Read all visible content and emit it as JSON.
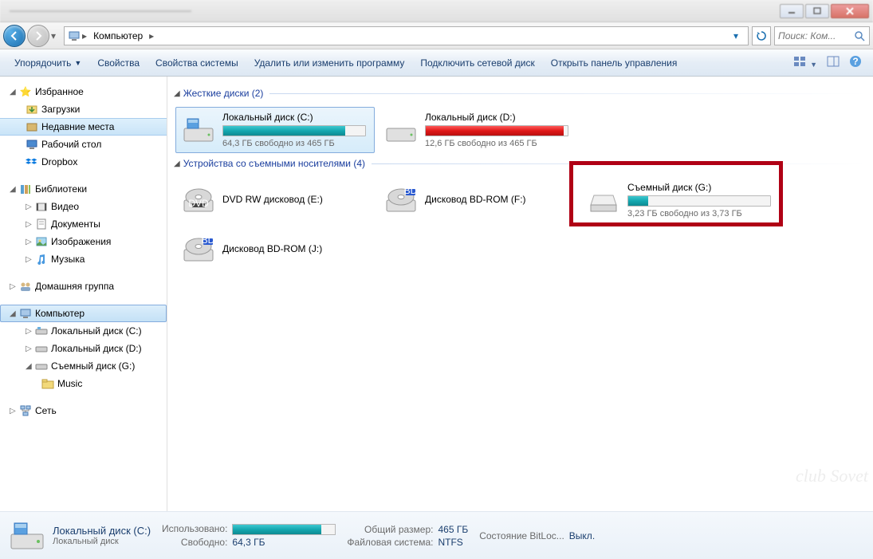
{
  "breadcrumb": {
    "item": "Компьютер"
  },
  "search": {
    "placeholder": "Поиск: Ком..."
  },
  "toolbar": {
    "organize": "Упорядочить",
    "properties": "Свойства",
    "sysprops": "Свойства системы",
    "uninstall": "Удалить или изменить программу",
    "mapnet": "Подключить сетевой диск",
    "controlpanel": "Открыть панель управления"
  },
  "sidebar": {
    "favorites": {
      "label": "Избранное",
      "downloads": "Загрузки",
      "recent": "Недавние места",
      "desktop": "Рабочий стол",
      "dropbox": "Dropbox"
    },
    "libraries": {
      "label": "Библиотеки",
      "video": "Видео",
      "docs": "Документы",
      "pics": "Изображения",
      "music": "Музыка"
    },
    "homegroup": "Домашняя группа",
    "computer": {
      "label": "Компьютер",
      "c": "Локальный диск (C:)",
      "d": "Локальный диск (D:)",
      "g": "Съемный диск (G:)",
      "g_sub": "Music"
    },
    "network": "Сеть"
  },
  "groups": {
    "hdd": {
      "title": "Жесткие диски (2)"
    },
    "removable": {
      "title": "Устройства со съемными носителями (4)"
    }
  },
  "drives": {
    "c": {
      "name": "Локальный диск (C:)",
      "free": "64,3 ГБ свободно из 465 ГБ",
      "pct": 86
    },
    "d": {
      "name": "Локальный диск (D:)",
      "free": "12,6 ГБ свободно из 465 ГБ",
      "pct": 97
    },
    "dvd": {
      "name": "DVD RW дисковод (E:)"
    },
    "bdf": {
      "name": "Дисковод BD-ROM (F:)"
    },
    "g": {
      "name": "Съемный диск (G:)",
      "free": "3,23 ГБ свободно из 3,73 ГБ",
      "pct": 14
    },
    "bdj": {
      "name": "Дисковод BD-ROM (J:)"
    }
  },
  "details": {
    "title": "Локальный диск (C:)",
    "subtitle": "Локальный диск",
    "used_label": "Использовано:",
    "free_label": "Свободно:",
    "free_val": "64,3 ГБ",
    "total_label": "Общий размер:",
    "total_val": "465 ГБ",
    "fs_label": "Файловая система:",
    "fs_val": "NTFS",
    "bitlocker_label": "Состояние BitLoc...",
    "bitlocker_val": "Выкл."
  },
  "watermark": "club Sovet"
}
